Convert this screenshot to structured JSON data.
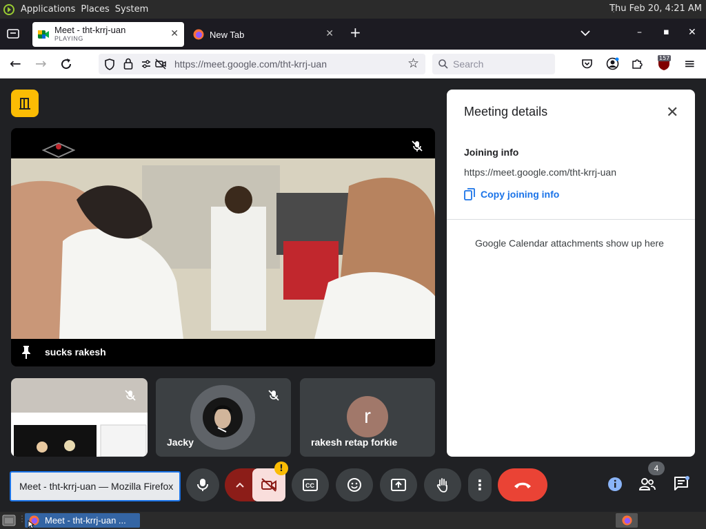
{
  "top_panel": {
    "menu": [
      "Applications",
      "Places",
      "System"
    ],
    "clock": "Thu Feb 20,  4:21 AM"
  },
  "browser": {
    "tabs": [
      {
        "title": "Meet - tht-krrj-uan",
        "subtitle": "PLAYING",
        "active": true
      },
      {
        "title": "New Tab",
        "active": false
      }
    ],
    "url": "https://meet.google.com/tht-krrj-uan",
    "search_placeholder": "Search",
    "extension_badge": "157"
  },
  "meet": {
    "main_tile": {
      "name": "sucks rakesh"
    },
    "tiles": [
      {
        "name": ""
      },
      {
        "name": "Jacky"
      },
      {
        "name": "rakesh retap forkie",
        "initial": "r"
      }
    ],
    "participants_count": "4",
    "tooltip": "Meet - tht-krrj-uan — Mozilla Firefox",
    "warning_badge": "!",
    "colors": {
      "accent": "#1a73e8",
      "end_call": "#ea4335",
      "host_badge": "#fbbc04"
    }
  },
  "details_panel": {
    "title": "Meeting details",
    "joining_info_label": "Joining info",
    "joining_url": "https://meet.google.com/tht-krrj-uan",
    "copy_label": "Copy joining info",
    "attachments_text": "Google Calendar attachments show up here"
  },
  "taskbar": {
    "window_title": "Meet - tht-krrj-uan ..."
  }
}
